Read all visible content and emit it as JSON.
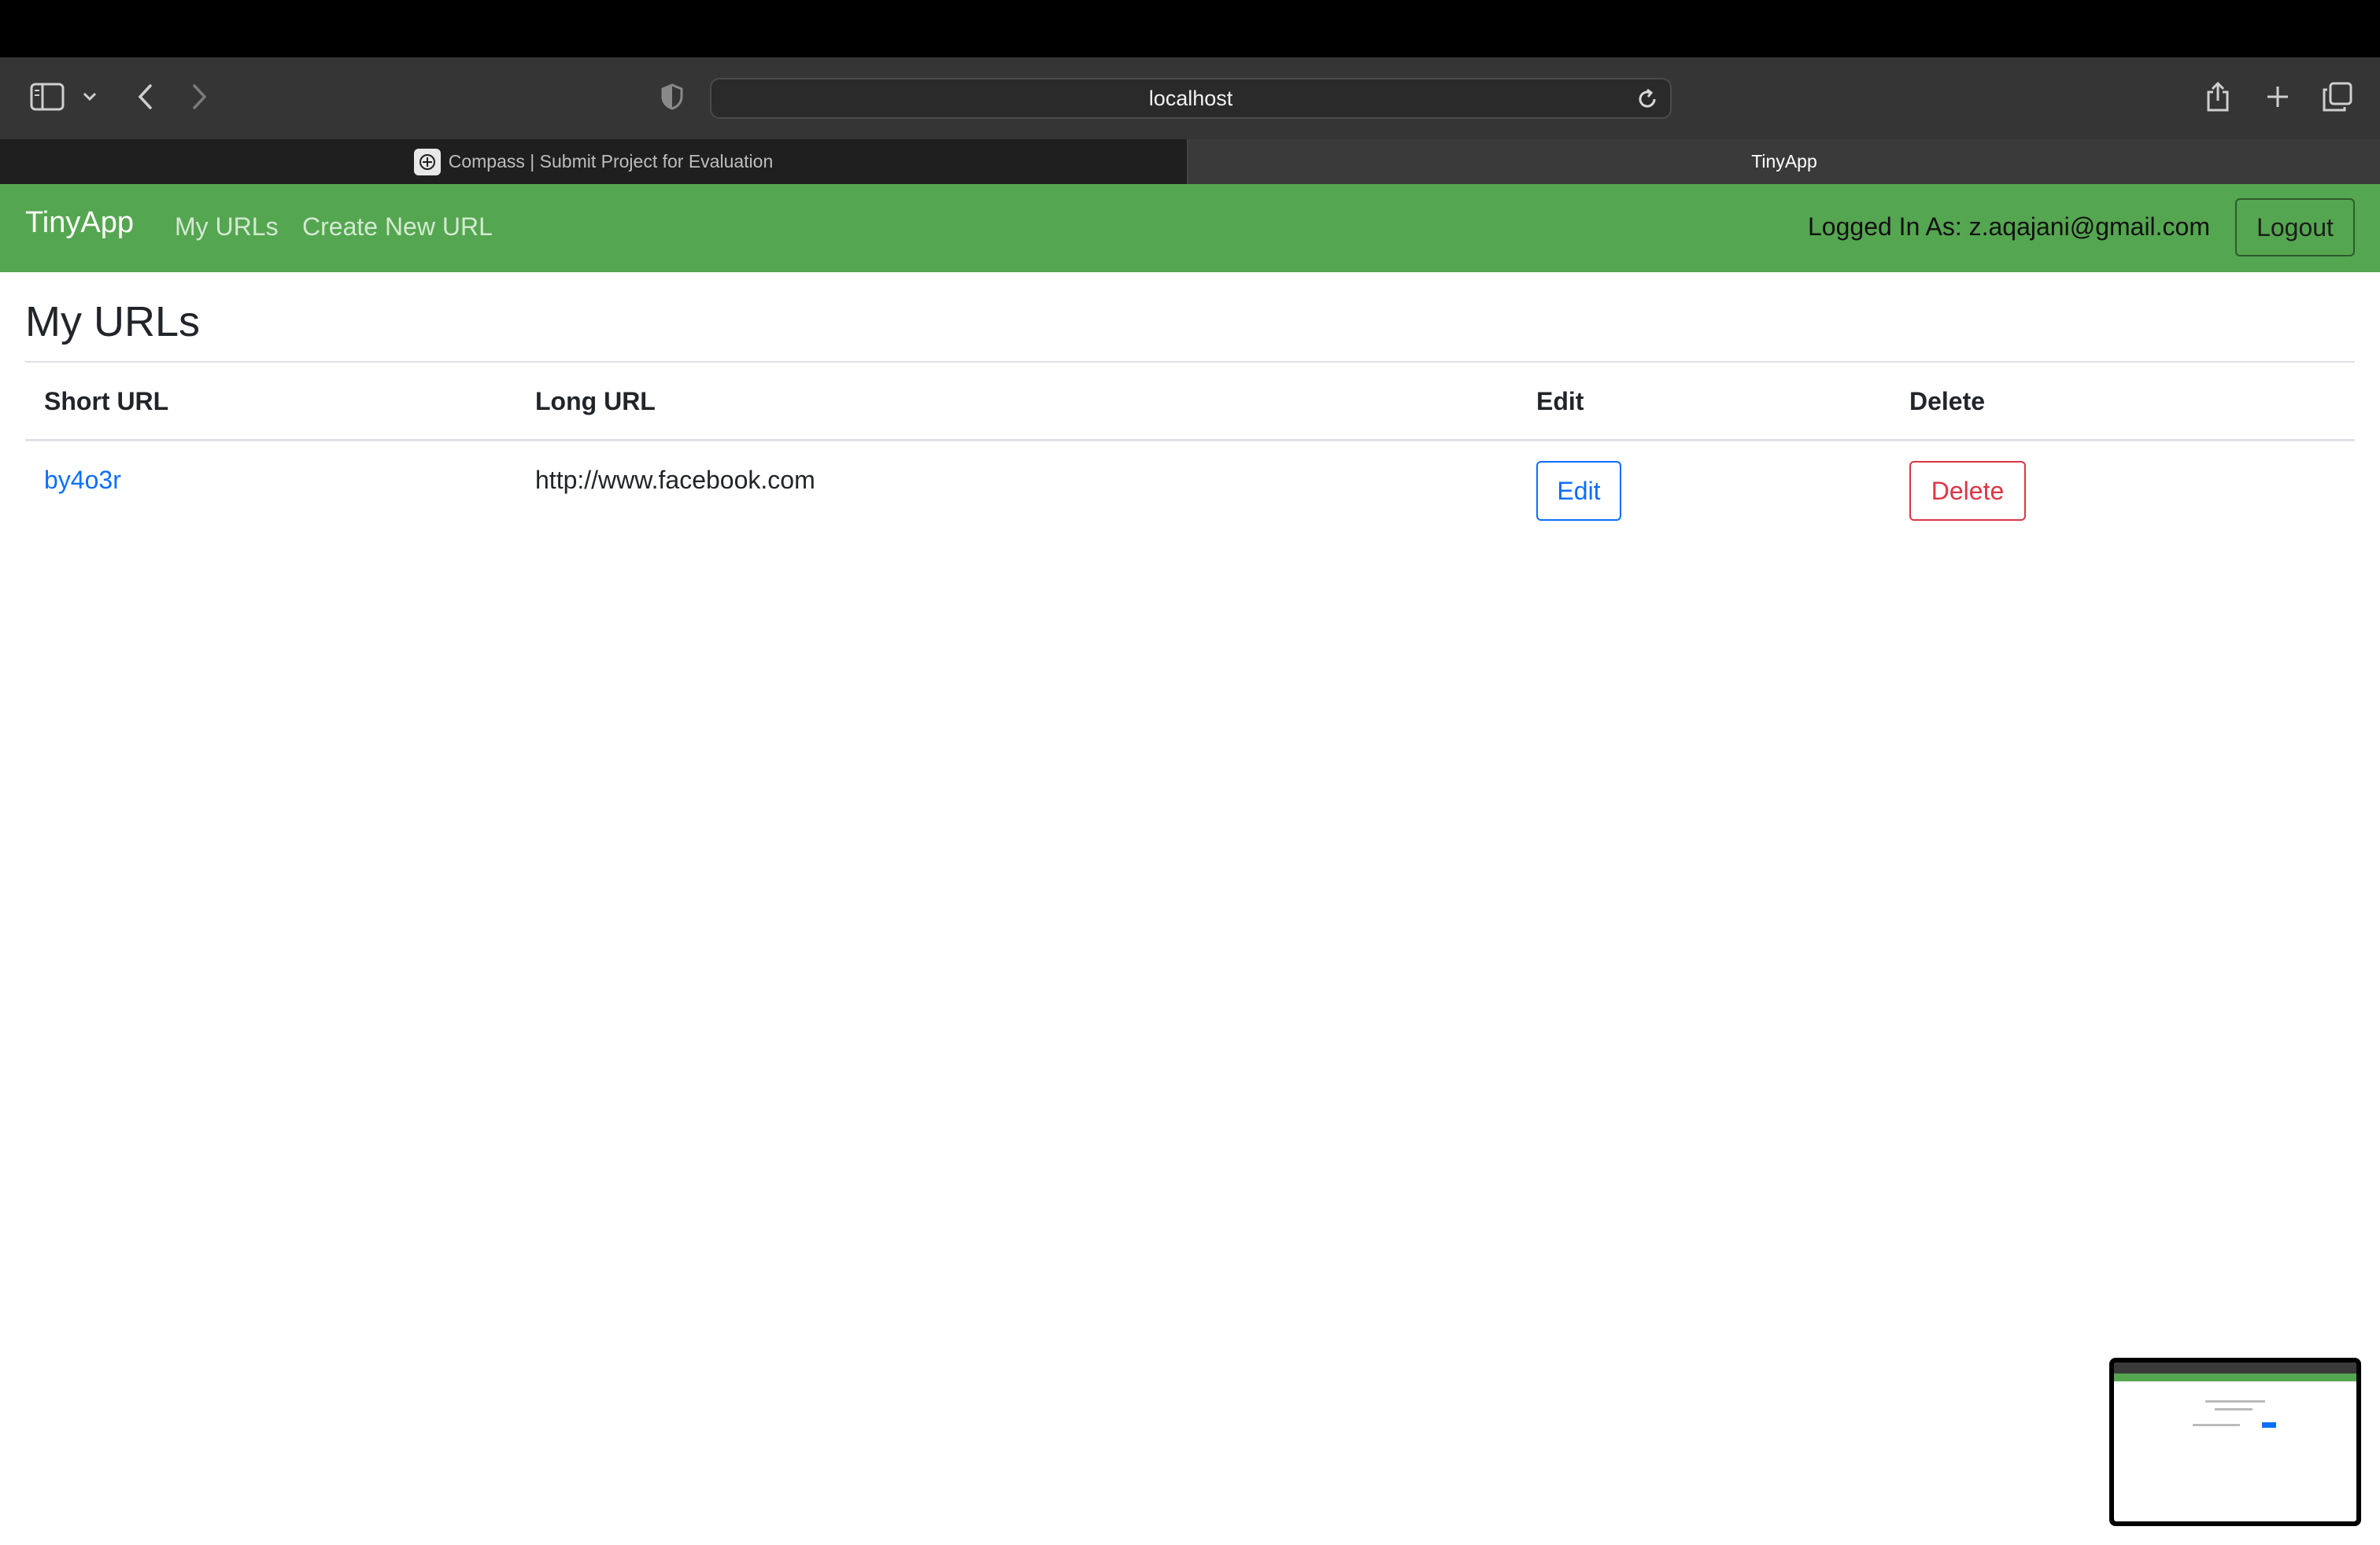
{
  "browser": {
    "address": "localhost",
    "tabs": [
      {
        "label": "Compass | Submit Project for Evaluation",
        "active": false
      },
      {
        "label": "TinyApp",
        "active": true
      }
    ]
  },
  "navbar": {
    "brand": "TinyApp",
    "links": [
      "My URLs",
      "Create New URL"
    ],
    "logged_in": "Logged In As: z.aqajani@gmail.com",
    "logout_label": "Logout",
    "color": "#55a650"
  },
  "page": {
    "title": "My URLs",
    "table": {
      "headers": [
        "Short URL",
        "Long URL",
        "Edit",
        "Delete"
      ],
      "rows": [
        {
          "short_url": "by4o3r",
          "long_url": "http://www.facebook.com",
          "edit_label": "Edit",
          "delete_label": "Delete"
        }
      ]
    }
  },
  "colors": {
    "link": "#0d6efd",
    "danger": "#dc3545"
  },
  "icons": [
    "sidebar-icon",
    "chevron-down-icon",
    "back-icon",
    "forward-icon",
    "shield-icon",
    "reload-icon",
    "share-icon",
    "plus-icon",
    "tabs-overview-icon"
  ]
}
